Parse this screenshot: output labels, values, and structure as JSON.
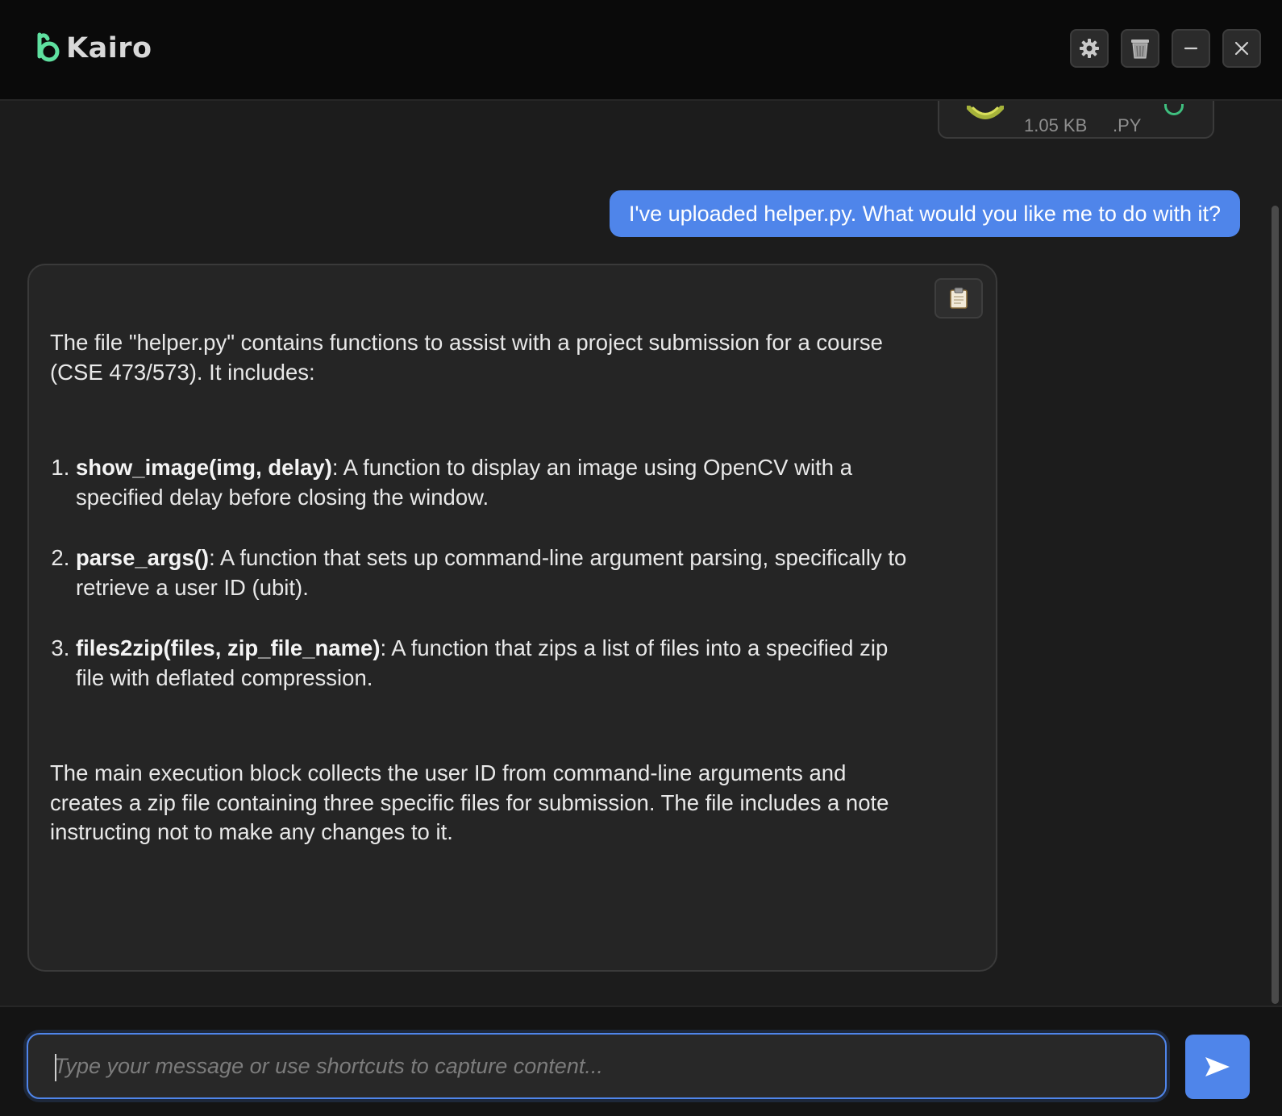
{
  "app": {
    "name": "Kairo",
    "brand_color": "#5fe0a0",
    "accent_color": "#4f85ea"
  },
  "header": {
    "buttons": [
      {
        "icon": "gear-icon",
        "action": "settings"
      },
      {
        "icon": "trash-icon",
        "action": "clear chat"
      },
      {
        "icon": "minimize-icon",
        "action": "minimize"
      },
      {
        "icon": "close-icon",
        "action": "close"
      }
    ]
  },
  "file_attachment": {
    "size": "1.05 KB",
    "extension": ".PY",
    "icon": "python-file-icon"
  },
  "messages": {
    "user": "I've uploaded helper.py. What would you like me to do with it?",
    "assistant": {
      "intro": "The file \"helper.py\" contains functions to assist with a project submission for a course (CSE 473/573). It includes:",
      "items": [
        {
          "title": "show_image(img, delay)",
          "text": ": A function to display an image using OpenCV with a specified delay before closing the window."
        },
        {
          "title": "parse_args()",
          "text": ": A function that sets up command-line argument parsing, specifically to retrieve a user ID (ubit)."
        },
        {
          "title": "files2zip(files, zip_file_name)",
          "text": ": A function that zips a list of files into a specified zip file with deflated compression."
        }
      ],
      "outro": "The main execution block collects the user ID from command-line arguments and creates a zip file containing three specific files for submission. The file includes a note instructing not to make any changes to it.",
      "copy_icon": "clipboard-icon"
    }
  },
  "composer": {
    "value": "",
    "placeholder": "Type your message or use shortcuts to capture content...",
    "send_icon": "send-icon"
  }
}
